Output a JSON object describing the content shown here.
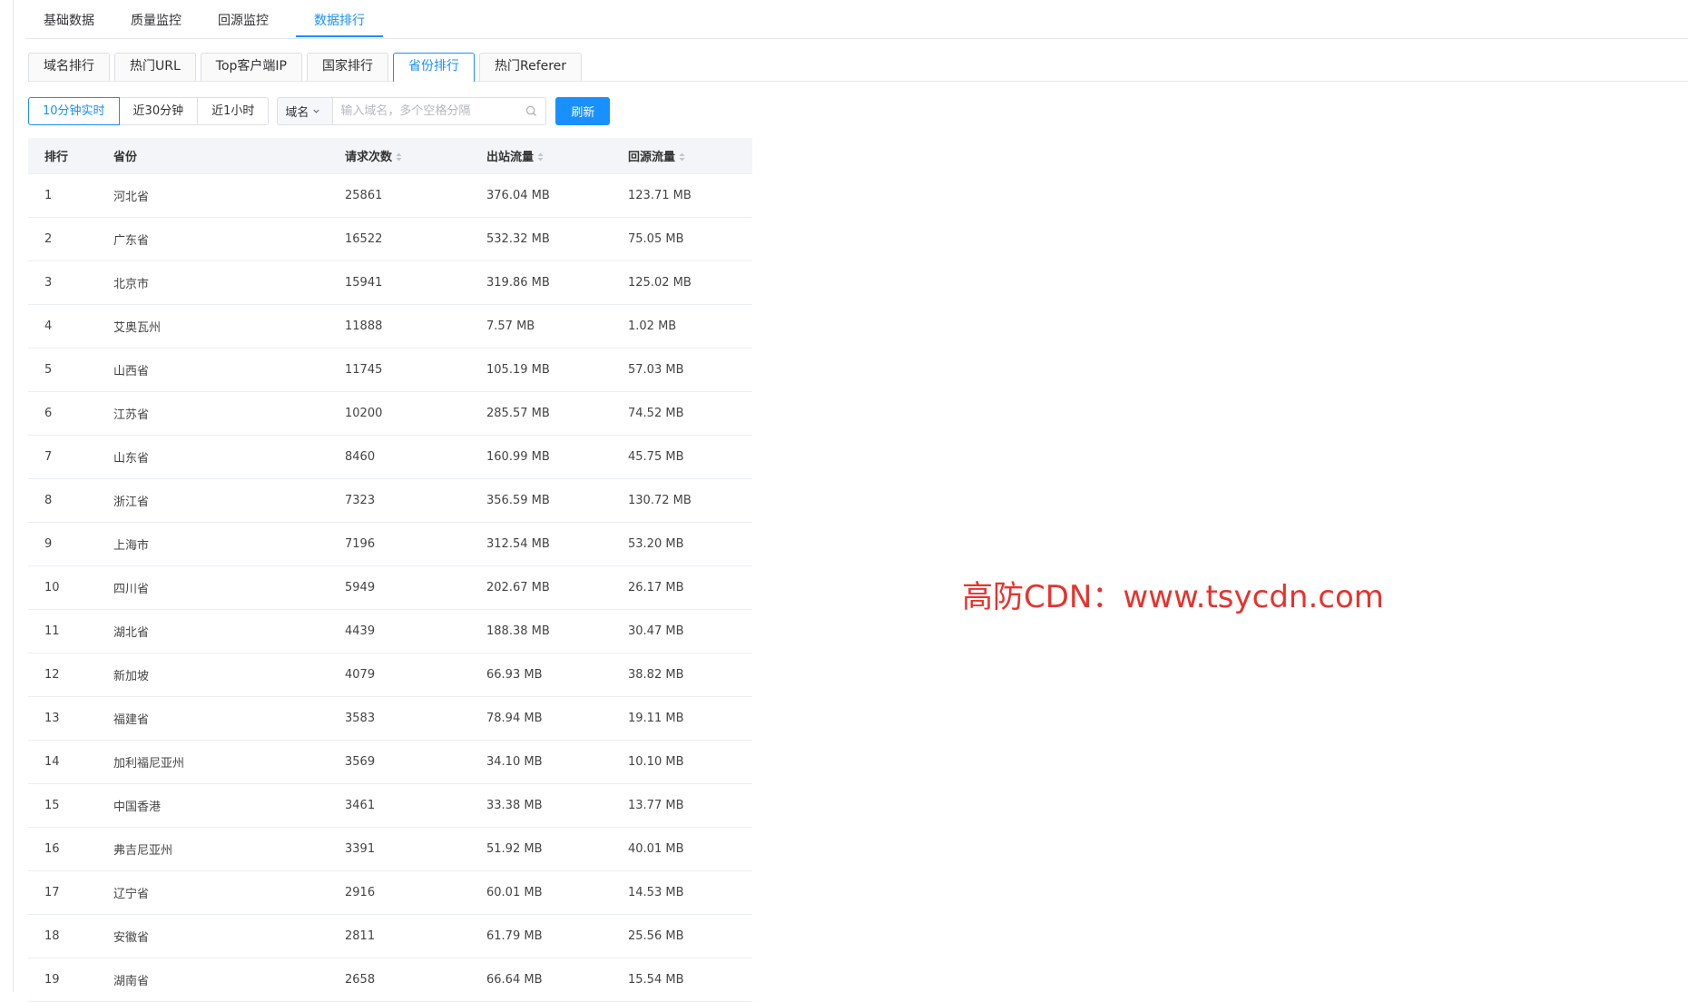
{
  "top_tabs": [
    "基础数据",
    "质量监控",
    "回源监控",
    "数据排行"
  ],
  "card_tabs": [
    "域名排行",
    "热门URL",
    "Top客户端IP",
    "国家排行",
    "省份排行",
    "热门Referer"
  ],
  "time_ranges": [
    "10分钟实时",
    "近30分钟",
    "近1小时"
  ],
  "search": {
    "field": "域名",
    "placeholder": "输入域名，多个空格分隔"
  },
  "refresh_label": "刷新",
  "table": {
    "headers": [
      "排行",
      "省份",
      "请求次数",
      "出站流量",
      "回源流量"
    ],
    "rows": [
      [
        "1",
        "河北省",
        "25861",
        "376.04 MB",
        "123.71 MB"
      ],
      [
        "2",
        "广东省",
        "16522",
        "532.32 MB",
        "75.05 MB"
      ],
      [
        "3",
        "北京市",
        "15941",
        "319.86 MB",
        "125.02 MB"
      ],
      [
        "4",
        "艾奥瓦州",
        "11888",
        "7.57 MB",
        "1.02 MB"
      ],
      [
        "5",
        "山西省",
        "11745",
        "105.19 MB",
        "57.03 MB"
      ],
      [
        "6",
        "江苏省",
        "10200",
        "285.57 MB",
        "74.52 MB"
      ],
      [
        "7",
        "山东省",
        "8460",
        "160.99 MB",
        "45.75 MB"
      ],
      [
        "8",
        "浙江省",
        "7323",
        "356.59 MB",
        "130.72 MB"
      ],
      [
        "9",
        "上海市",
        "7196",
        "312.54 MB",
        "53.20 MB"
      ],
      [
        "10",
        "四川省",
        "5949",
        "202.67 MB",
        "26.17 MB"
      ],
      [
        "11",
        "湖北省",
        "4439",
        "188.38 MB",
        "30.47 MB"
      ],
      [
        "12",
        "新加坡",
        "4079",
        "66.93 MB",
        "38.82 MB"
      ],
      [
        "13",
        "福建省",
        "3583",
        "78.94 MB",
        "19.11 MB"
      ],
      [
        "14",
        "加利福尼亚州",
        "3569",
        "34.10 MB",
        "10.10 MB"
      ],
      [
        "15",
        "中国香港",
        "3461",
        "33.38 MB",
        "13.77 MB"
      ],
      [
        "16",
        "弗吉尼亚州",
        "3391",
        "51.92 MB",
        "40.01 MB"
      ],
      [
        "17",
        "辽宁省",
        "2916",
        "60.01 MB",
        "14.53 MB"
      ],
      [
        "18",
        "安徽省",
        "2811",
        "61.79 MB",
        "25.56 MB"
      ],
      [
        "19",
        "湖南省",
        "2658",
        "66.64 MB",
        "15.54 MB"
      ]
    ]
  },
  "watermark": "高防CDN：www.tsycdn.com",
  "colors": {
    "accent": "#1890ff",
    "watermark": "#e8322c",
    "header_bg": "#f3f5f8"
  }
}
